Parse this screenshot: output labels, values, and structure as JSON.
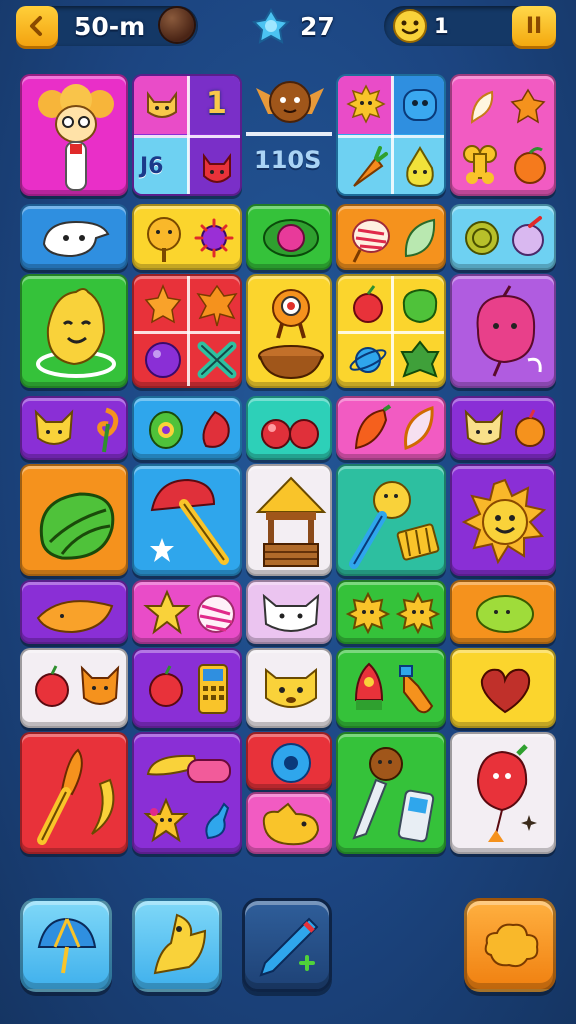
{
  "hud": {
    "distance_label": "50-m",
    "gem_count": "27",
    "player_count": "1",
    "pause_label": "II",
    "icons": [
      "back-arrow-icon",
      "brown-orb-icon",
      "blue-gem-icon",
      "smiley-face-icon",
      "pause-icon"
    ]
  },
  "board": {
    "labels": {
      "number_one": "1",
      "code_left": "J6",
      "code_center": "110S"
    },
    "tile_colors": {
      "magenta": "#e92fc8",
      "purple": "#8a2fd6",
      "blue": "#2fa6ec",
      "green": "#35c23a",
      "orange": "#f5921d",
      "red": "#e8323a",
      "yellow": "#fbd52d",
      "pink": "#f25bc2",
      "teal": "#2dd0b8",
      "white": "#f3eef3"
    },
    "tiles": [
      {
        "name": "poodle-character-tile",
        "icons": [
          "poodle-character-icon"
        ]
      },
      {
        "name": "cat-number-tile",
        "icons": [
          "cat-face-icon",
          "number-one-icon",
          "devil-face-icon"
        ]
      },
      {
        "name": "hedgehog-tile",
        "icons": [
          "hedgehog-icon"
        ]
      },
      {
        "name": "sun-blob-tile",
        "icons": [
          "sun-face-icon",
          "blue-blob-icon",
          "carrot-icon",
          "pear-face-icon"
        ]
      },
      {
        "name": "fruits-tile",
        "icons": [
          "feather-icon",
          "orange-fruit-icon",
          "bone-icon",
          "peach-icon"
        ]
      },
      {
        "name": "ghost-cat-tile",
        "icons": [
          "ghost-cat-icon"
        ]
      },
      {
        "name": "acorn-bug-tile",
        "icons": [
          "acorn-face-icon",
          "purple-bug-icon"
        ]
      },
      {
        "name": "pink-orb-tile",
        "icons": [
          "pink-orb-icon"
        ]
      },
      {
        "name": "shell-leaf-tile",
        "icons": [
          "shell-icon",
          "leaf-icon"
        ]
      },
      {
        "name": "coin-bug-tile",
        "icons": [
          "green-coin-icon",
          "eggplant-icon"
        ]
      },
      {
        "name": "lemon-cat-tile",
        "icons": [
          "lemon-cat-icon"
        ]
      },
      {
        "name": "leaf-grid-tile",
        "icons": [
          "orange-leaf-icon",
          "maple-leaf-icon",
          "purple-orb-icon",
          "x-cross-icon"
        ]
      },
      {
        "name": "cyclops-tile",
        "icons": [
          "cyclops-icon",
          "bowl-icon"
        ]
      },
      {
        "name": "veggie-grid-tile",
        "icons": [
          "tomato-icon",
          "lettuce-icon",
          "planet-icon",
          "spinach-icon"
        ]
      },
      {
        "name": "pink-monster-tile",
        "icons": [
          "pink-monster-icon"
        ]
      },
      {
        "name": "fox-hook-tile",
        "icons": [
          "fox-face-icon",
          "hook-icon"
        ]
      },
      {
        "name": "eye-rose-tile",
        "icons": [
          "green-eye-icon",
          "rose-icon"
        ]
      },
      {
        "name": "cherries-tile",
        "icons": [
          "cherries-icon"
        ]
      },
      {
        "name": "pepper-feather-tile",
        "icons": [
          "pepper-icon",
          "feather-icon"
        ]
      },
      {
        "name": "fox-apple-tile",
        "icons": [
          "fox-face-icon",
          "apple-icon"
        ]
      },
      {
        "name": "watermelon-tile",
        "icons": [
          "watermelon-icon"
        ]
      },
      {
        "name": "umbrella-tile",
        "icons": [
          "umbrella-icon",
          "splash-icon"
        ]
      },
      {
        "name": "gazebo-tile",
        "icons": [
          "gazebo-icon"
        ]
      },
      {
        "name": "lollipop-tile",
        "icons": [
          "lollipop-face-icon",
          "flute-icon"
        ]
      },
      {
        "name": "sun-face-tile",
        "icons": [
          "sun-face-icon"
        ]
      },
      {
        "name": "taco-tile",
        "icons": [
          "taco-icon"
        ]
      },
      {
        "name": "star-shell-tile",
        "icons": [
          "star-icon",
          "shell-icon"
        ]
      },
      {
        "name": "cat-head-tile",
        "icons": [
          "cat-head-icon"
        ]
      },
      {
        "name": "virus-tile",
        "icons": [
          "virus-icon",
          "virus-icon"
        ]
      },
      {
        "name": "lime-tile",
        "icons": [
          "lime-icon"
        ]
      },
      {
        "name": "apple-fox-tile",
        "icons": [
          "apple-icon",
          "fox-face-icon"
        ]
      },
      {
        "name": "tomato-phone-tile",
        "icons": [
          "tomato-icon",
          "calculator-icon"
        ]
      },
      {
        "name": "hamster-tile",
        "icons": [
          "hamster-face-icon"
        ]
      },
      {
        "name": "rocket-bottle-tile",
        "icons": [
          "rocket-icon",
          "bottle-icon"
        ]
      },
      {
        "name": "heart-tile",
        "icons": [
          "heart-icon"
        ]
      },
      {
        "name": "brush-banana-tile",
        "icons": [
          "paintbrush-icon",
          "banana-icon"
        ]
      },
      {
        "name": "banana-star-tile",
        "icons": [
          "banana-icon",
          "candy-icon",
          "star-face-icon",
          "bottle-icon"
        ]
      },
      {
        "name": "donut-tile",
        "icons": [
          "blue-donut-icon"
        ]
      },
      {
        "name": "bird-tile",
        "icons": [
          "bird-icon"
        ]
      },
      {
        "name": "knife-phone-tile",
        "icons": [
          "knife-face-icon",
          "phone-icon"
        ]
      },
      {
        "name": "balloon-tile",
        "icons": [
          "balloon-face-icon",
          "sparkle-icon"
        ]
      }
    ]
  },
  "toolbar": {
    "buttons": [
      {
        "name": "umbrella-powerup-button",
        "icon": "umbrella-icon"
      },
      {
        "name": "cheese-powerup-button",
        "icon": "cheese-icon"
      },
      {
        "name": "pen-add-button",
        "icon": "pen-plus-icon"
      },
      {
        "name": "cloud-shuffle-button",
        "icon": "cloud-icon"
      }
    ]
  }
}
